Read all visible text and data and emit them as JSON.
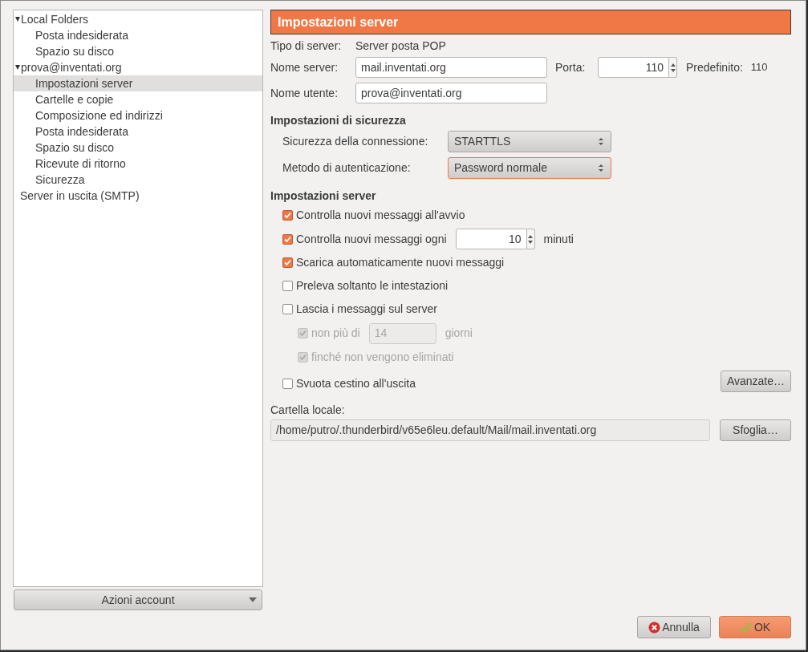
{
  "sidebar": {
    "tree": [
      {
        "label": "Local Folders",
        "expanded": true,
        "selected": false,
        "children": [
          {
            "label": "Posta indesiderata",
            "selected": false
          },
          {
            "label": "Spazio su disco",
            "selected": false
          }
        ]
      },
      {
        "label": "prova@inventati.org",
        "expanded": true,
        "selected": false,
        "children": [
          {
            "label": "Impostazioni server",
            "selected": true
          },
          {
            "label": "Cartelle e copie",
            "selected": false
          },
          {
            "label": "Composizione ed indirizzi",
            "selected": false
          },
          {
            "label": "Posta indesiderata",
            "selected": false
          },
          {
            "label": "Spazio su disco",
            "selected": false
          },
          {
            "label": "Ricevute di ritorno",
            "selected": false
          },
          {
            "label": "Sicurezza",
            "selected": false
          }
        ]
      },
      {
        "label": "Server in uscita (SMTP)",
        "selected": false
      }
    ],
    "actions_button": "Azioni account"
  },
  "panel": {
    "title": "Impostazioni server",
    "server_type": {
      "label": "Tipo di server:",
      "value": "Server posta POP"
    },
    "server_name": {
      "label": "Nome server:",
      "value": "mail.inventati.org"
    },
    "port": {
      "label": "Porta:",
      "value": "110",
      "default_label": "Predefinito:",
      "default_value": "110"
    },
    "user_name": {
      "label": "Nome utente:",
      "value": "prova@inventati.org"
    },
    "security": {
      "heading": "Impostazioni di sicurezza",
      "rows": [
        {
          "label": "Sicurezza della connessione:",
          "value": "STARTTLS",
          "focused": false
        },
        {
          "label": "Metodo di autenticazione:",
          "value": "Password normale",
          "focused": true
        }
      ]
    },
    "server": {
      "heading": "Impostazioni server",
      "checks": [
        {
          "label": "Controlla nuovi messaggi all'avvio",
          "checked": true,
          "disabled": false
        },
        {
          "label": "Controlla nuovi messaggi ogni",
          "checked": true,
          "disabled": false,
          "spin": "10",
          "suffix": "minuti"
        },
        {
          "label": "Scarica automaticamente nuovi messaggi",
          "checked": true,
          "disabled": false
        },
        {
          "label": "Preleva soltanto le intestazioni",
          "checked": false,
          "disabled": false
        },
        {
          "label": "Lascia i messaggi sul server",
          "checked": false,
          "disabled": false,
          "children": [
            {
              "label": "non più di",
              "checked": true,
              "disabled": true,
              "field": "14",
              "suffix": "giorni"
            },
            {
              "label": "finché non vengono eliminati",
              "checked": true,
              "disabled": true
            }
          ]
        },
        {
          "label": "Svuota cestino all'uscita",
          "checked": false,
          "disabled": false,
          "button": "Avanzate…"
        }
      ]
    },
    "local_folder": {
      "label": "Cartella locale:",
      "value": "/home/putro/.thunderbird/v65e6leu.default/Mail/mail.inventati.org",
      "button": "Sfoglia…"
    }
  },
  "buttons": [
    {
      "kind": "cancel",
      "label": "Annulla"
    },
    {
      "kind": "ok",
      "label": "OK"
    }
  ]
}
